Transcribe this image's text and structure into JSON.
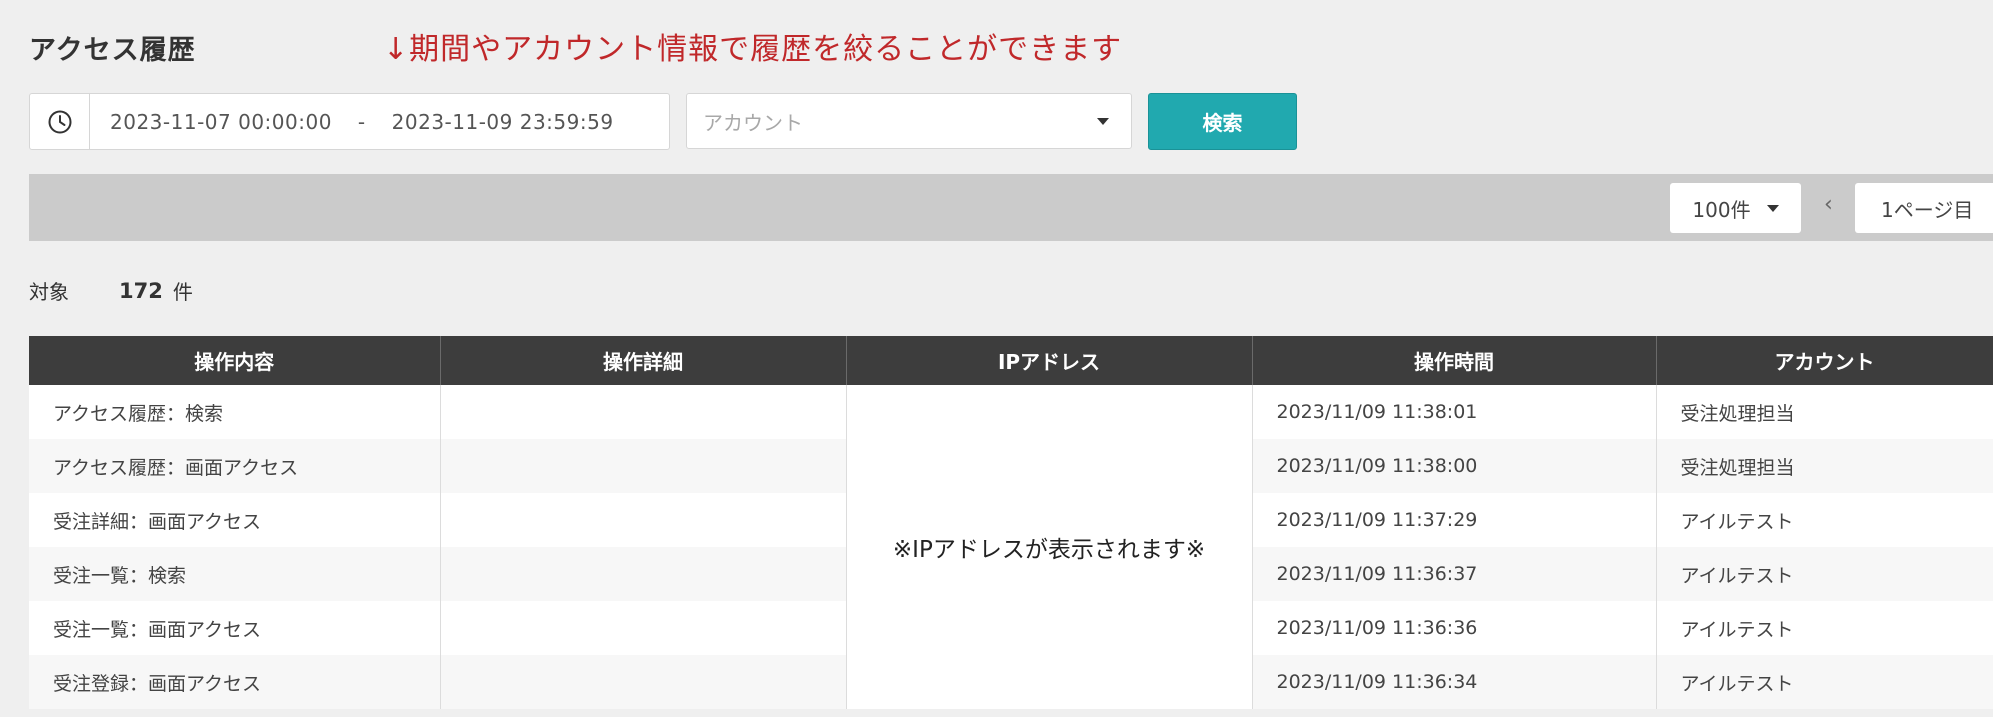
{
  "page": {
    "title": "アクセス履歴",
    "note": "↓期間やアカウント情報で履歴を絞ることができます"
  },
  "filter": {
    "clock_icon": "clock-icon",
    "date_from": "2023-11-07 00:00:00",
    "date_separator": "-",
    "date_to": "2023-11-09 23:59:59",
    "account_placeholder": "アカウント",
    "search_label": "検索",
    "accent_color": "#21a9af"
  },
  "pagination": {
    "per_page": "100件",
    "page": "1ページ目"
  },
  "summary": {
    "label": "対象",
    "count": "172",
    "unit": "件"
  },
  "table": {
    "headers": [
      "操作内容",
      "操作詳細",
      "IPアドレス",
      "操作時間",
      "アカウント"
    ],
    "ip_note": "※IPアドレスが表示されます※",
    "rows": [
      {
        "action": "アクセス履歴：検索",
        "detail": "",
        "time": "2023/11/09 11:38:01",
        "account": "受注処理担当"
      },
      {
        "action": "アクセス履歴：画面アクセス",
        "detail": "",
        "time": "2023/11/09 11:38:00",
        "account": "受注処理担当"
      },
      {
        "action": "受注詳細：画面アクセス",
        "detail": "",
        "time": "2023/11/09 11:37:29",
        "account": "アイルテスト"
      },
      {
        "action": "受注一覧：検索",
        "detail": "",
        "time": "2023/11/09 11:36:37",
        "account": "アイルテスト"
      },
      {
        "action": "受注一覧：画面アクセス",
        "detail": "",
        "time": "2023/11/09 11:36:36",
        "account": "アイルテスト"
      },
      {
        "action": "受注登録：画面アクセス",
        "detail": "",
        "time": "2023/11/09 11:36:34",
        "account": "アイルテスト"
      }
    ]
  }
}
